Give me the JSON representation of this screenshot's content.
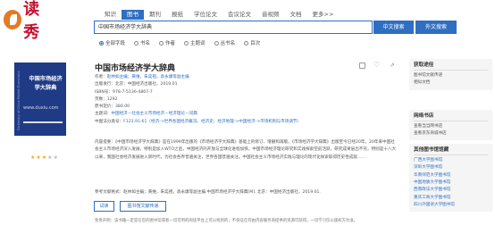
{
  "logo": {
    "text": "读秀"
  },
  "nav": {
    "items": [
      "知识",
      "图书",
      "期刊",
      "报纸",
      "学位论文",
      "会议论文",
      "音视频",
      "文档",
      "更多>>"
    ],
    "active_index": 1
  },
  "search": {
    "value": "中国市场经济学大辞典",
    "btn_cn": "中文搜索",
    "btn_en": "外文搜索"
  },
  "filters": [
    {
      "label": "全部字段",
      "checked": true
    },
    {
      "label": "书名",
      "checked": false
    },
    {
      "label": "作者",
      "checked": false
    },
    {
      "label": "主题词",
      "checked": false
    },
    {
      "label": "丛书名",
      "checked": false
    },
    {
      "label": "目次",
      "checked": false
    }
  ],
  "cover": {
    "en_title": "Dictionary of China Market Economics",
    "title": "中国市场经济学大辞典",
    "watermark": "www.duxiu.com"
  },
  "rating": {
    "value": 3,
    "max": 5
  },
  "book": {
    "title": "中国市场经济学大辞典",
    "fields": [
      {
        "label": "作者：",
        "value": "赵林如主编；黄维，朱奕祖，袁永康等副主编"
      },
      {
        "label": "出版发行：",
        "value": "北京：中国经济出版社，2019.01"
      },
      {
        "label": "ISBN号：",
        "value": "978-7-5136-4867-7"
      },
      {
        "label": "页数：",
        "value": "1292"
      },
      {
        "label": "原书定价：",
        "value": "380.00"
      },
      {
        "label": "主题词：",
        "value": "中国经济－社会主义市场经济－经济理论－词典"
      },
      {
        "label": "中图法分类号：",
        "value": "F123.91-61（经济->世界各国经济概况、经济史、经济地理->中国经济->市场机制与市场调节）"
      }
    ],
    "summary_label": "内容提要：",
    "summary": "《中国市场经济学大辞典》是在1999年出版的《市场经济学大辞典》基础上的修订、增删和再版。《市场经济学大辞典》出版至今已经20年。20年来中国社会主义市场经济深入发展，特别是加入WTO之后，中国经济的开放与全球化进程加快，中国市场经济理论研究和实践探索空前活跃，研究成果层出不穷。特别是十八大以来，我国社会经济发展进入新时代，为社会各界普遍关注，世界各国普遍关注。中国社会主义市场经济实践与理论的现代化探索取得历史性成就……",
    "cite": "参考文献格式：赵林如主编；黄维，朱奕祖，袁永康等副主编.中国市场经济学大辞典[M]. 北京：中国经济出版社，2019.01."
  },
  "actions": {
    "trial": "试读",
    "deliver": "图书馆文献传递"
  },
  "disclaimer": "免责声明：该书籍一定是在您的图书馆或者一切可用的阅读平台上可以找到的；不保证任何由内容服务商提供的资源可获得，一切学习仅以版权方为准。",
  "sidebar": {
    "panels": [
      {
        "title": "获取途径",
        "items": [
          "图书馆文献传递",
          "相似文档"
        ],
        "links": false
      },
      {
        "title": "网络书店",
        "items": [
          "查看当当网书店",
          "查看京东商城书店"
        ],
        "links": false
      },
      {
        "title": "其他图书馆馆藏",
        "items": [
          "广西大学图书馆",
          "深圳大学图书馆",
          "华南师范大学图书馆",
          "中国地质大学图书馆",
          "西南政法大学图书馆",
          "重庆工商大学图书馆",
          "四川外国语大学图书馆"
        ],
        "links": true
      }
    ]
  }
}
